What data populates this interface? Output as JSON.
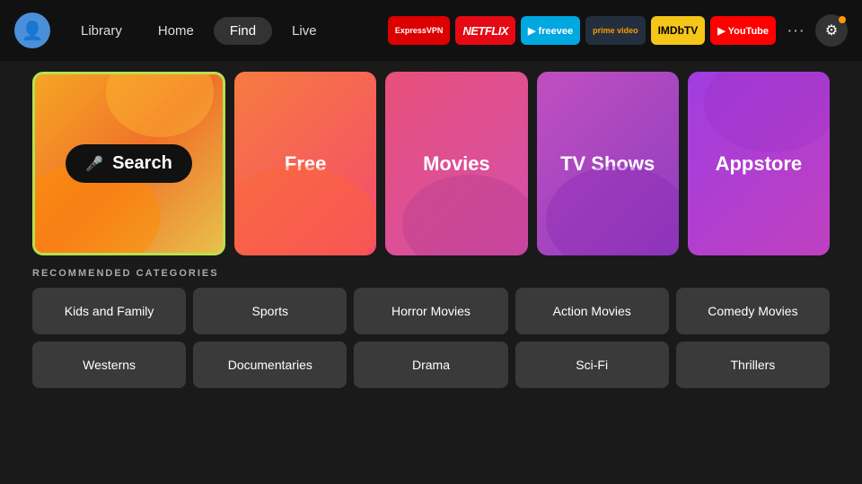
{
  "nav": {
    "avatar_icon": "👤",
    "links": [
      {
        "label": "Library",
        "active": false
      },
      {
        "label": "Home",
        "active": false
      },
      {
        "label": "Find",
        "active": true
      },
      {
        "label": "Live",
        "active": false
      }
    ],
    "apps": [
      {
        "id": "expressvpn",
        "label": "ExpressVPN",
        "cls": "app-expressvpn"
      },
      {
        "id": "netflix",
        "label": "NETFLIX",
        "cls": "app-netflix"
      },
      {
        "id": "freevee",
        "label": "▶ freevee",
        "cls": "app-freevee"
      },
      {
        "id": "prime",
        "label": "prime video",
        "cls": "app-prime"
      },
      {
        "id": "imdb",
        "label": "IMDbTV",
        "cls": "app-imdb"
      },
      {
        "id": "youtube",
        "label": "▶ YouTube",
        "cls": "app-youtube"
      }
    ],
    "more_label": "···",
    "settings_icon": "⚙"
  },
  "tiles": [
    {
      "id": "search",
      "label": "Search",
      "mic_icon": "🎤",
      "type": "search"
    },
    {
      "id": "free",
      "label": "Free",
      "type": "normal"
    },
    {
      "id": "movies",
      "label": "Movies",
      "type": "normal"
    },
    {
      "id": "tvshows",
      "label": "TV Shows",
      "type": "normal"
    },
    {
      "id": "appstore",
      "label": "Appstore",
      "type": "normal"
    }
  ],
  "categories": {
    "title": "RECOMMENDED CATEGORIES",
    "items": [
      "Kids and Family",
      "Sports",
      "Horror Movies",
      "Action Movies",
      "Comedy Movies",
      "Westerns",
      "Documentaries",
      "Drama",
      "Sci-Fi",
      "Thrillers"
    ]
  }
}
